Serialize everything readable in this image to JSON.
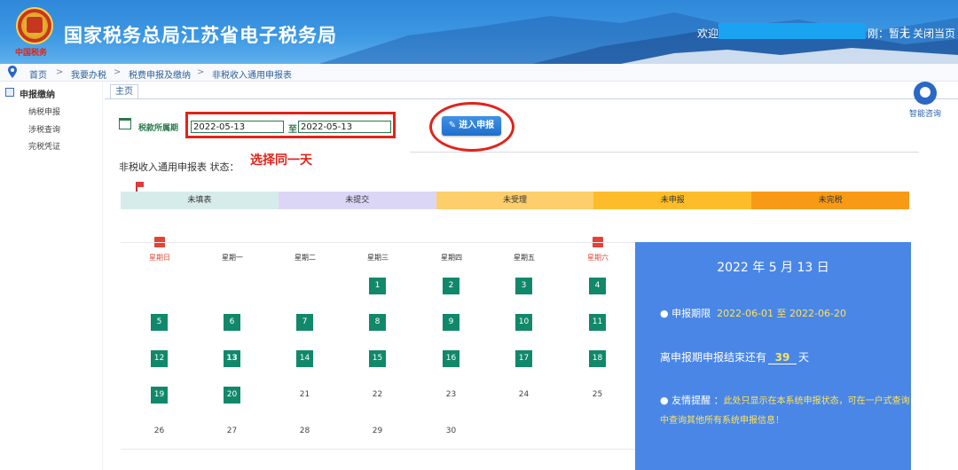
{
  "header": {
    "emblem_text": "中国税务",
    "title": "国家税务总局江苏省电子税务局",
    "welcome": "欢迎",
    "role_text": "刚：暂无",
    "separator": "|",
    "close_label": "关闭当页"
  },
  "breadcrumb": {
    "items": [
      "首页",
      "我要办税",
      "税费申报及缴纳",
      "非税收入通用申报表"
    ],
    "separator": ">"
  },
  "sidebar": {
    "heading": "申报缴纳",
    "items": [
      "纳税申报",
      "涉税查询",
      "完税凭证"
    ]
  },
  "tab": {
    "label": "主页"
  },
  "form": {
    "period_label": "税款所属期",
    "start_date": "2022-05-13",
    "to_label": "至",
    "end_date": "2022-05-13",
    "enter_button": "进入申报",
    "annotation": "选择同一天",
    "status_title": "非税收入通用申报表 状态："
  },
  "status_legend": [
    {
      "label": "未填表",
      "color": "#d6ecea"
    },
    {
      "label": "未提交",
      "color": "#dcd6f6"
    },
    {
      "label": "未受理",
      "color": "#fccf6c"
    },
    {
      "label": "未申报",
      "color": "#fdbd2a"
    },
    {
      "label": "未完税",
      "color": "#f99a17"
    }
  ],
  "calendar": {
    "weekdays": [
      "星期日",
      "星期一",
      "星期二",
      "星期三",
      "星期四",
      "星期五",
      "星期六"
    ],
    "weekend_indices": [
      0,
      6
    ],
    "weeks": [
      [
        "",
        "",
        "",
        "",
        "",
        "",
        ""
      ],
      [
        "",
        "",
        "",
        "1",
        "2",
        "3",
        "4"
      ],
      [
        "5",
        "6",
        "7",
        "8",
        "9",
        "10",
        "11"
      ],
      [
        "12",
        "13",
        "14",
        "15",
        "16",
        "17",
        "18"
      ],
      [
        "19",
        "20",
        "21",
        "22",
        "23",
        "24",
        "25"
      ],
      [
        "26",
        "27",
        "28",
        "29",
        "30",
        "",
        ""
      ]
    ],
    "active_days": [
      "1",
      "2",
      "3",
      "4",
      "5",
      "6",
      "7",
      "8",
      "9",
      "10",
      "11",
      "12",
      "13",
      "14",
      "15",
      "16",
      "17",
      "18",
      "19",
      "20"
    ],
    "today": "13"
  },
  "info": {
    "date": "2022 年 5 月 13 日",
    "period_prefix": "● 申报期限",
    "period_range": "2022-06-01 至 2022-06-20",
    "remain_prefix": "离申报期申报结束还有",
    "remain_days": "39",
    "remain_suffix": "天",
    "remind_lead": "● 友情提醒 ：",
    "remind_body": "此处只显示在本系统申报状态，可在一户式查询中查询其他所有系统申报信息！"
  },
  "consult": {
    "label": "智能咨询"
  }
}
